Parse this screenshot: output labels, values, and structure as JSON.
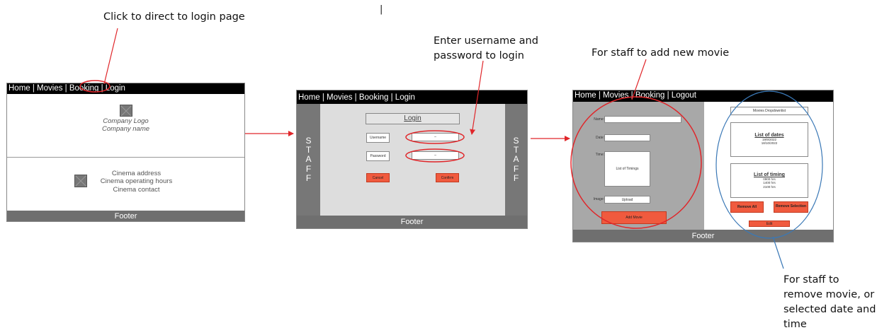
{
  "annotations": {
    "login_click": "Click to direct to login page",
    "enter_credentials_1": "Enter username and",
    "enter_credentials_2": "password to login",
    "add_movie": "For staff to add new movie",
    "remove_1": "For staff to",
    "remove_2": "remove movie, or",
    "remove_3": "selected date and",
    "remove_4": "time",
    "separator": "|"
  },
  "screen1": {
    "nav": "Home | Movies | Booking | Login",
    "logo_line1": "Company Logo",
    "logo_line2": "Company name",
    "info_line1": "Cinema address",
    "info_line2": "Cinema operating hours",
    "info_line3": "Cinema contact",
    "footer": "Footer"
  },
  "screen2": {
    "nav": "Home | Movies | Booking | Login",
    "staff_letters": [
      "S",
      "T",
      "A",
      "F",
      "F"
    ],
    "title": "Login",
    "username_label": "Username",
    "password_label": "Password",
    "field_placeholder": "–",
    "cancel": "Cancel",
    "confirm": "Confirm",
    "footer": "Footer"
  },
  "screen3": {
    "nav": "Home | Movies | Booking | Logout",
    "name_label": "Name:",
    "date_label": "Date:",
    "time_label": "Time:",
    "timings_box": "List of Timings",
    "image_label": "Image:",
    "upload": "Upload",
    "add_movie": "Add Movie",
    "dropdown": "Movies Dropdownlist",
    "dates_title": "List of dates",
    "dates": [
      "19/9/2022",
      "18/10/2022"
    ],
    "timing_title": "List of timing",
    "timings": [
      "0900 hrs",
      "1400 hrs",
      "2100 hrs"
    ],
    "remove_all": "Remove All",
    "remove_selection": "Remove Selection",
    "edit": "Edit",
    "footer": "Footer"
  },
  "colors": {
    "annotation_red": "#e0262a",
    "ellipse_blue": "#3a78b6",
    "button_red": "#f05a3e",
    "nav_black": "#000000",
    "footer_gray": "#6f6f6f"
  }
}
